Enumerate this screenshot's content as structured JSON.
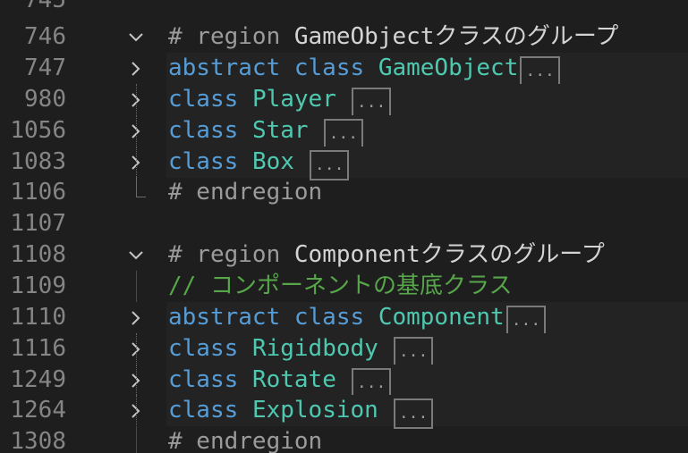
{
  "lines": [
    {
      "num": "745"
    },
    {
      "num": "746",
      "directive": "# region",
      "name": "GameObjectクラスのグループ"
    },
    {
      "num": "747",
      "kw": "abstract class",
      "cls": "GameObject",
      "ellipsis": "..."
    },
    {
      "num": "980",
      "kw": "class",
      "cls": "Player",
      "ellipsis": "..."
    },
    {
      "num": "1056",
      "kw": "class",
      "cls": "Star",
      "ellipsis": "..."
    },
    {
      "num": "1083",
      "kw": "class",
      "cls": "Box",
      "ellipsis": "..."
    },
    {
      "num": "1106",
      "directive": "# endregion"
    },
    {
      "num": "1107"
    },
    {
      "num": "1108",
      "directive": "# region",
      "name": "Componentクラスのグループ"
    },
    {
      "num": "1109",
      "comment": "// コンポーネントの基底クラス"
    },
    {
      "num": "1110",
      "kw": "abstract class",
      "cls": "Component",
      "ellipsis": "..."
    },
    {
      "num": "1116",
      "kw": "class",
      "cls": "Rigidbody",
      "ellipsis": "..."
    },
    {
      "num": "1249",
      "kw": "class",
      "cls": "Rotate",
      "ellipsis": "..."
    },
    {
      "num": "1264",
      "kw": "class",
      "cls": "Explosion",
      "ellipsis": "..."
    },
    {
      "num": "1308",
      "directive": "# endregion"
    }
  ],
  "colors": {
    "background": "#1e1e1e",
    "line_number": "#858585",
    "keyword": "#569cd6",
    "class_name": "#4ec9b0",
    "comment": "#57a64a"
  }
}
